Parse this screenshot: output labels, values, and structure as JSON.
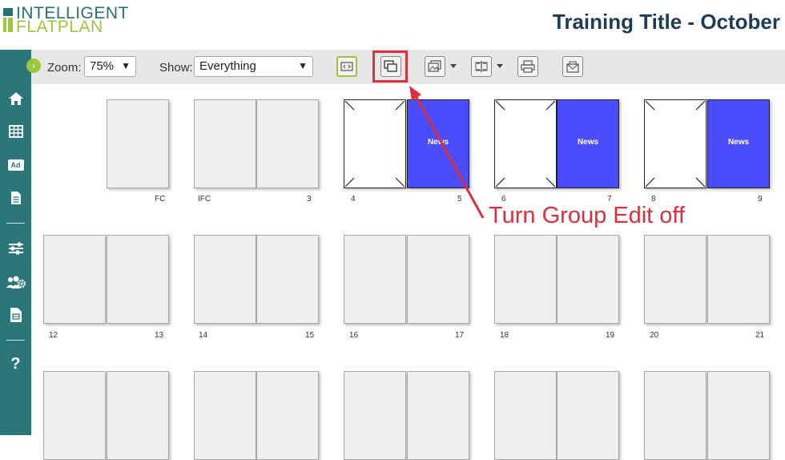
{
  "header": {
    "logo_line1": "INTELLIGENT",
    "logo_line2": "FLATPLAN",
    "title": "Training Title - October"
  },
  "toolbar": {
    "zoom_label": "Zoom:",
    "zoom_value": "75%",
    "show_label": "Show:",
    "show_value": "Everything"
  },
  "annotation": {
    "text": "Turn Group Edit off",
    "color": "#d9303f"
  },
  "sidebar": {
    "items": [
      "home-icon",
      "grid-icon",
      "ad-icon",
      "document-icon",
      "sliders-icon",
      "users-gear-icon",
      "report-icon",
      "help-icon"
    ],
    "ad_label": "Ad",
    "help_label": "?"
  },
  "flatplan": {
    "row1": {
      "fc": "FC",
      "ifc": "IFC",
      "p3": "3",
      "p4": "4",
      "p5": "5",
      "p6": "6",
      "p7": "7",
      "p8": "8",
      "p9": "9",
      "news": "News"
    },
    "row2": {
      "p12": "12",
      "p13": "13",
      "p14": "14",
      "p15": "15",
      "p16": "16",
      "p17": "17",
      "p18": "18",
      "p19": "19",
      "p20": "20",
      "p21": "21"
    }
  },
  "colors": {
    "sidebar": "#2b7679",
    "accent_green": "#9cc63b",
    "news_blue": "#4b4cfb",
    "title": "#1f3c55"
  }
}
